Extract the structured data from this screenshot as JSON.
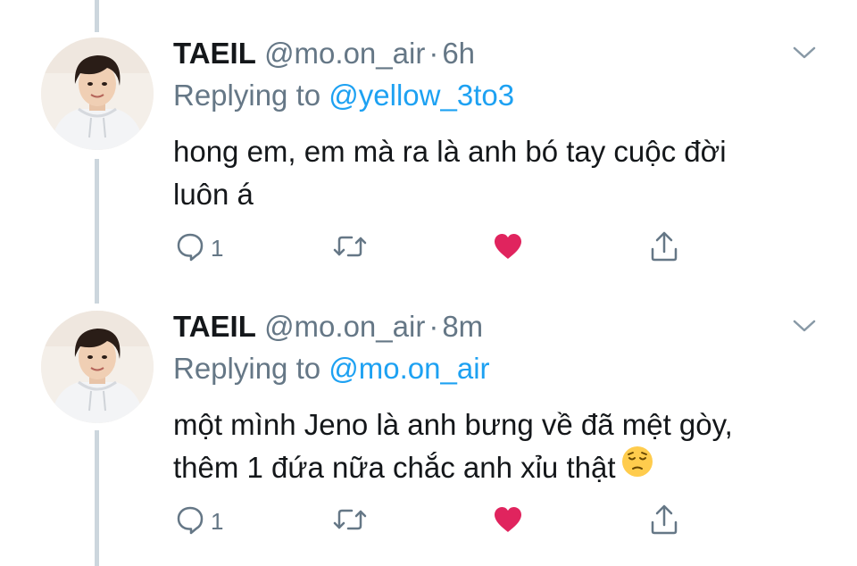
{
  "tweets": [
    {
      "display_name": "TAEIL",
      "handle": "@mo.on_air",
      "separator": "·",
      "time": "6h",
      "replying_label": "Replying to",
      "reply_to": "@yellow_3to3",
      "text_lines": [
        "hong em, em mà ra là anh bó tay cuộc đời",
        "luôn á"
      ],
      "reply_count": "1",
      "liked": true
    },
    {
      "display_name": "TAEIL",
      "handle": "@mo.on_air",
      "separator": "·",
      "time": "8m",
      "replying_label": "Replying to",
      "reply_to": "@mo.on_air",
      "text_lines": [
        "một mình Jeno là anh bưng về đã mệt gòy,",
        "thêm 1 đứa nữa chắc anh xỉu thật"
      ],
      "emoji": "pensive-face",
      "reply_count": "1",
      "liked": true
    }
  ],
  "icons": {
    "reply": "reply-icon",
    "retweet": "retweet-icon",
    "like": "heart-icon",
    "share": "share-icon",
    "menu": "chevron-down-icon"
  },
  "colors": {
    "text": "#14171a",
    "secondary": "#657786",
    "link": "#1da1f2",
    "like": "#e0245e",
    "thread_line": "#ccd6dd"
  }
}
